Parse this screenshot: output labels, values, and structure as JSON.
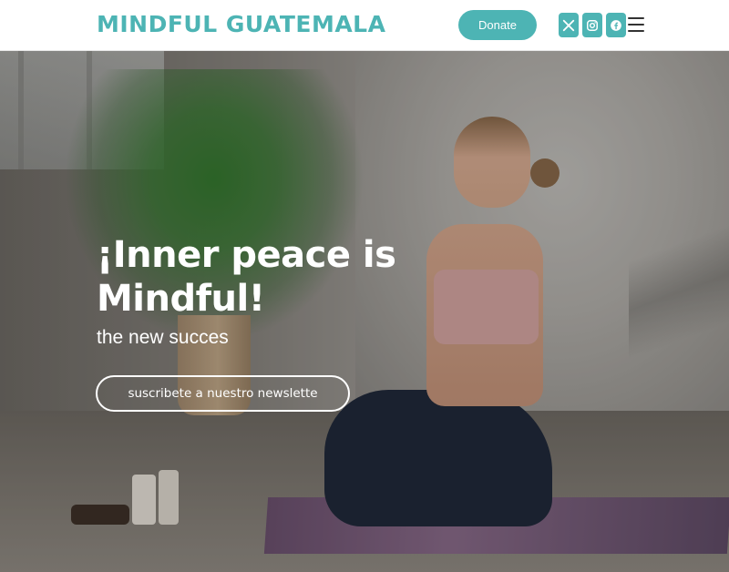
{
  "header": {
    "logo": "MINDFUL GUATEMALA",
    "donate_label": "Donate",
    "social": [
      {
        "icon": "x-icon"
      },
      {
        "icon": "instagram-icon"
      },
      {
        "icon": "facebook-icon"
      }
    ],
    "menu_icon": "hamburger-menu-icon"
  },
  "hero": {
    "title": "¡Inner peace is Mindful!",
    "subtitle": "the new succes",
    "cta_label": "suscribete a nuestro newslette"
  },
  "colors": {
    "accent": "#4db4b4",
    "header_bg": "#ffffff",
    "hero_text": "#ffffff"
  }
}
